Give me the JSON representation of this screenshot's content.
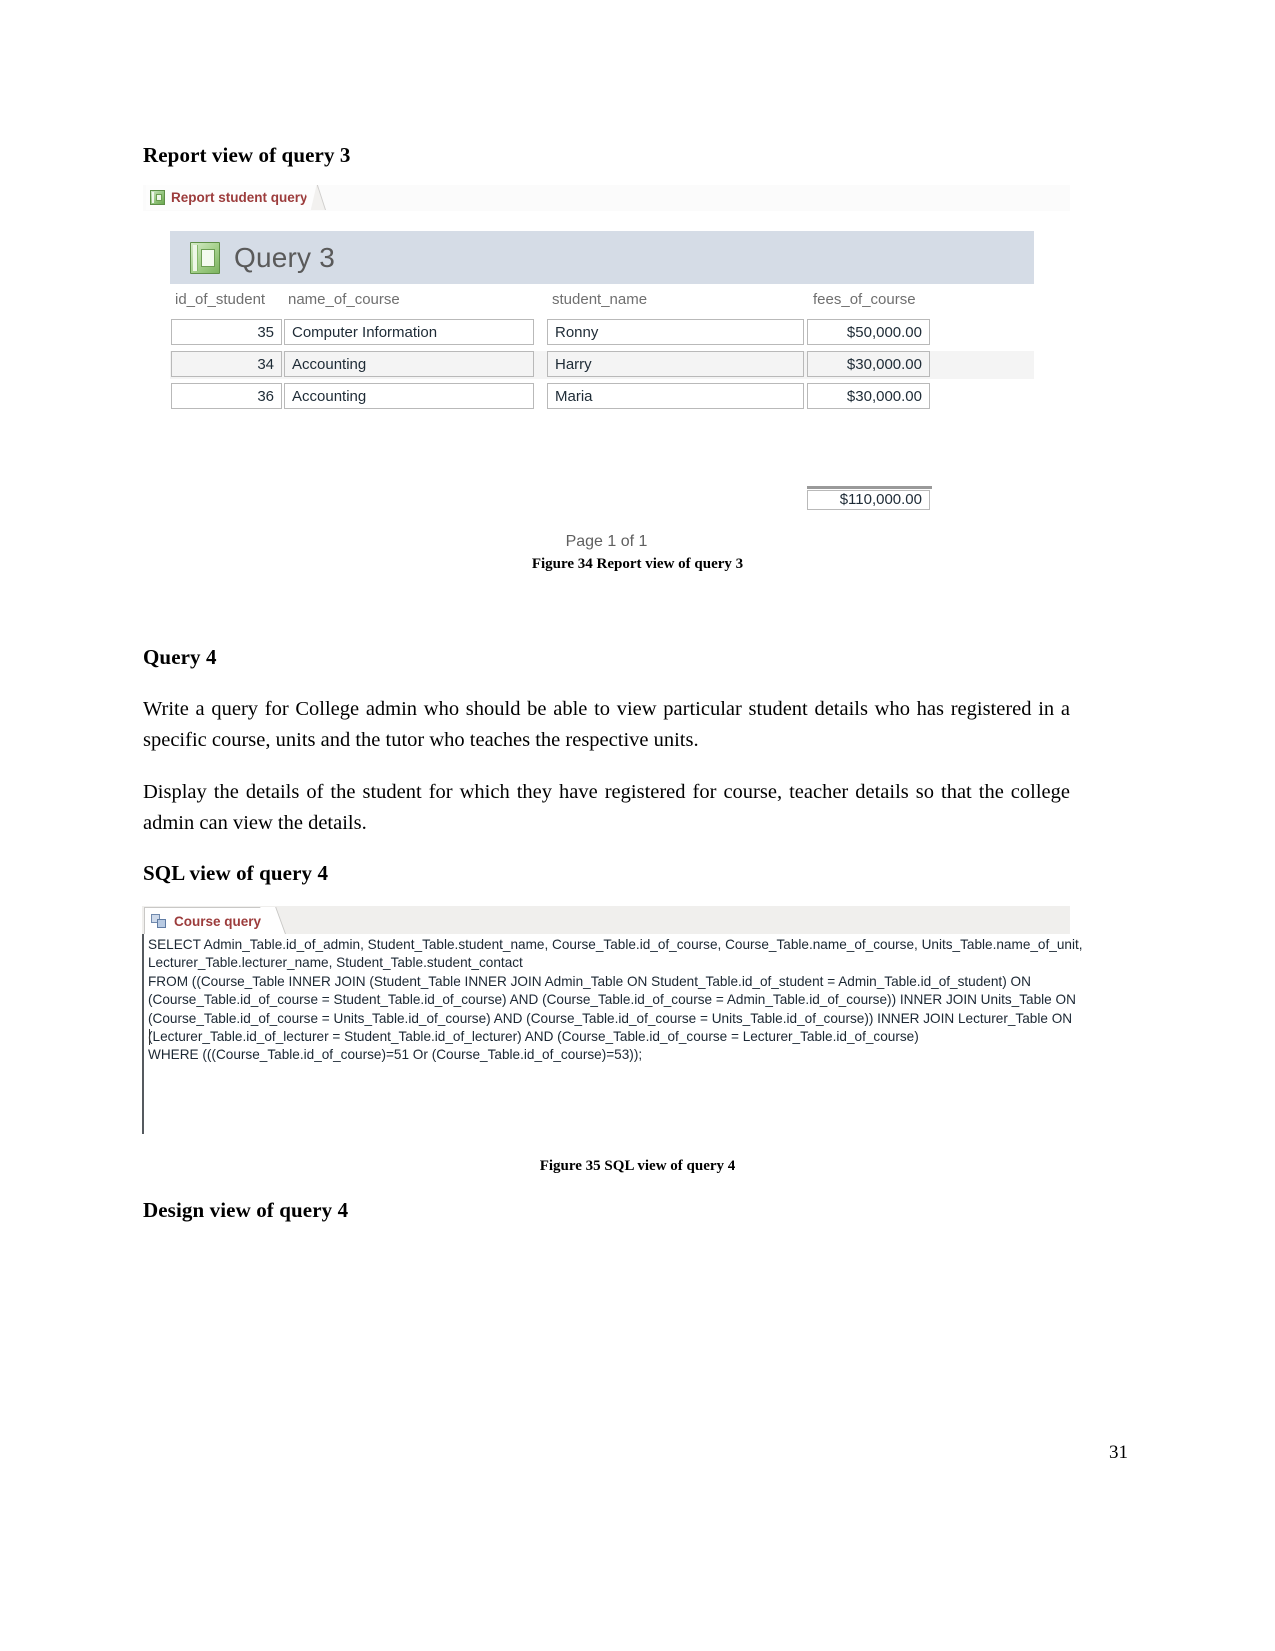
{
  "document": {
    "page_number": "31",
    "headings": {
      "report_view_query3": "Report view of query 3",
      "query4": "Query 4",
      "sql_view_query4": "SQL view of query 4",
      "design_view_query4": "Design view of query 4"
    },
    "paragraphs": {
      "query4_p1": "Write a query for College admin who should be able to view particular student details who has registered in a specific course, units and the tutor who teaches the respective units.",
      "query4_p2": "Display the details of the student for which they have registered for course, teacher details so that the college admin can view the details."
    },
    "captions": {
      "figure34": "Figure 34 Report view of query 3",
      "figure35": "Figure 35 SQL view of query 4"
    }
  },
  "report_screenshot": {
    "tab": {
      "label": "Report student query",
      "icon": "report-object-icon"
    },
    "report_title": "Query 3",
    "report_title_icon": "report-object-icon",
    "columns": [
      "id_of_student",
      "name_of_course",
      "student_name",
      "fees_of_course"
    ],
    "rows": [
      {
        "id_of_student": "35",
        "name_of_course": "Computer Information",
        "student_name": "Ronny",
        "fees_of_course": "$50,000.00"
      },
      {
        "id_of_student": "34",
        "name_of_course": "Accounting",
        "student_name": "Harry",
        "fees_of_course": "$30,000.00"
      },
      {
        "id_of_student": "36",
        "name_of_course": "Accounting",
        "student_name": "Maria",
        "fees_of_course": "$30,000.00"
      }
    ],
    "total": "$110,000.00",
    "page_footer": "Page 1 of 1",
    "colors": {
      "title_band": "#d5dce6",
      "tab_text": "#9c3c3c",
      "alt_row": "#f4f4f4"
    }
  },
  "sql_screenshot": {
    "tab": {
      "label": "Course query",
      "icon": "query-object-icon"
    },
    "sql": "SELECT Admin_Table.id_of_admin, Student_Table.student_name, Course_Table.id_of_course, Course_Table.name_of_course, Units_Table.name_of_unit,\nLecturer_Table.lecturer_name, Student_Table.student_contact\nFROM ((Course_Table INNER JOIN (Student_Table INNER JOIN Admin_Table ON Student_Table.id_of_student = Admin_Table.id_of_student) ON\n(Course_Table.id_of_course = Student_Table.id_of_course) AND (Course_Table.id_of_course = Admin_Table.id_of_course)) INNER JOIN Units_Table ON\n(Course_Table.id_of_course = Units_Table.id_of_course) AND (Course_Table.id_of_course = Units_Table.id_of_course)) INNER JOIN Lecturer_Table ON\n(Lecturer_Table.id_of_lecturer = Student_Table.id_of_lecturer) AND (Course_Table.id_of_course = Lecturer_Table.id_of_course)\nWHERE (((Course_Table.id_of_course)=51 Or (Course_Table.id_of_course)=53));",
    "colors": {
      "tab_text": "#9c3c3c",
      "text": "#1b2733"
    }
  }
}
